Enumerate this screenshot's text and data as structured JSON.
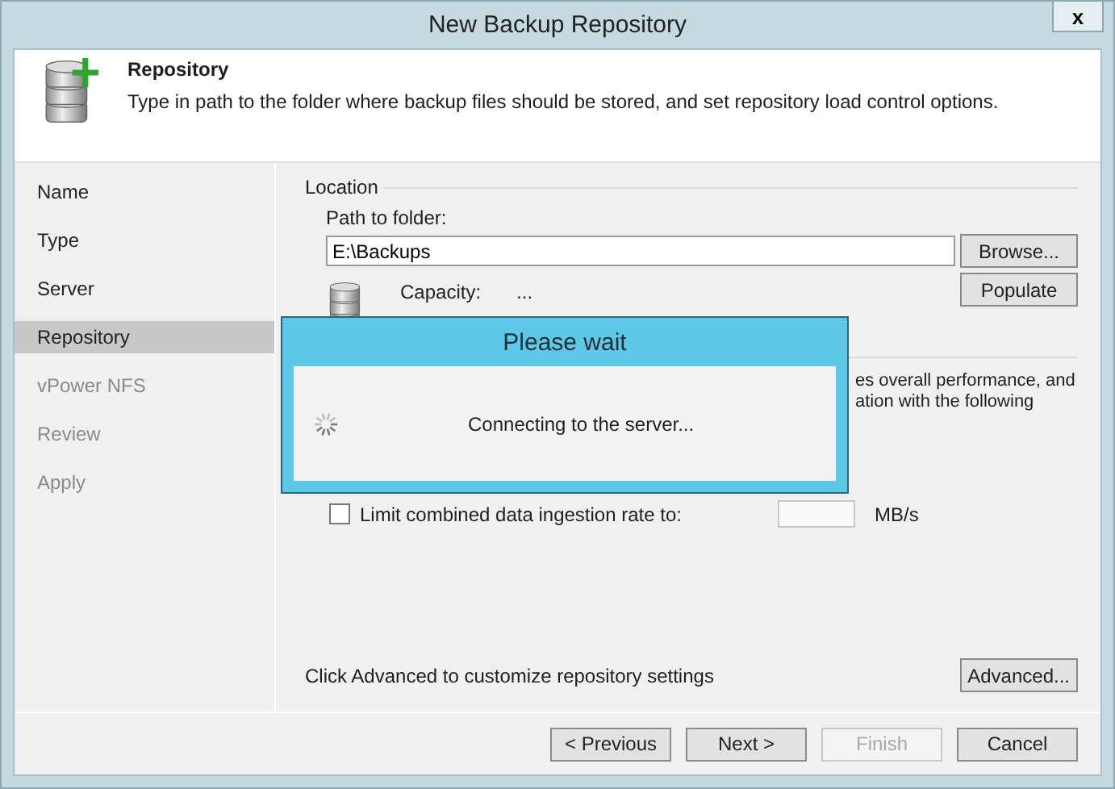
{
  "window": {
    "title": "New Backup Repository",
    "close": "x"
  },
  "header": {
    "title": "Repository",
    "description": "Type in path to the folder where backup files should be stored, and set repository load control options."
  },
  "sidebar": {
    "items": [
      {
        "label": "Name",
        "selected": false,
        "disabled": false
      },
      {
        "label": "Type",
        "selected": false,
        "disabled": false
      },
      {
        "label": "Server",
        "selected": false,
        "disabled": false
      },
      {
        "label": "Repository",
        "selected": true,
        "disabled": false
      },
      {
        "label": "vPower NFS",
        "selected": false,
        "disabled": true
      },
      {
        "label": "Review",
        "selected": false,
        "disabled": true
      },
      {
        "label": "Apply",
        "selected": false,
        "disabled": true
      }
    ]
  },
  "location": {
    "group": "Location",
    "path_label": "Path to folder:",
    "path_value": "E:\\Backups",
    "browse": "Browse...",
    "capacity_label": "Capacity:",
    "capacity_value": "...",
    "populate": "Populate"
  },
  "load_control": {
    "lines": [
      "es overall performance, and",
      "ation with the following"
    ],
    "limit_label": "Limit combined data ingestion rate to:",
    "limit_checked": false,
    "unit": "MB/s"
  },
  "advanced": {
    "text": "Click Advanced to customize repository settings",
    "button": "Advanced..."
  },
  "buttons": [
    {
      "label": "< Previous",
      "disabled": false
    },
    {
      "label": "Next >",
      "disabled": false
    },
    {
      "label": "Finish",
      "disabled": true
    },
    {
      "label": "Cancel",
      "disabled": false
    }
  ],
  "wait_dialog": {
    "title": "Please wait",
    "message": "Connecting to the server..."
  }
}
